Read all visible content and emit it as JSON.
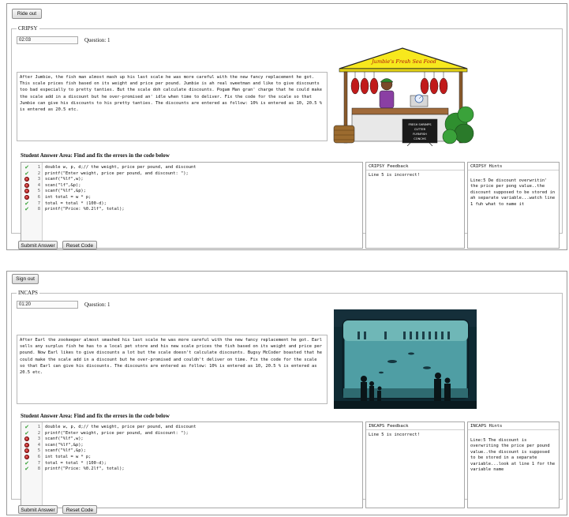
{
  "top": {
    "logout_label": "Ride out",
    "legend": "CRIPSY",
    "timer": "02:03",
    "question_label": "Question: 1",
    "question_text": "After Jumbie, the fish man almost mash up his last scale he was more careful with the new fancy replacement he got. This scale prices fish based on its weight and price per pound. Jumbie is ah real sweetman and like to give discounts too bad especially to pretty tanties. But the scale doh calculate discounts. Pogam Man gran' charge that he could make the scale add in a discount but he over-promised an' idle when time to deliver. Fix the code for the scale so that Jumbie can give his discounts to his pretty tanties. The discounts are entered as follow: 10% is entered as 10, 20.5 % is entered as 20.5 etc.",
    "illustration": {
      "sign": "Jumbie's Fresh Sea Food",
      "board": "FRESH SHRIMPS\nCUTTER\nFLYINFISH\nCONCHS"
    },
    "answer_label": "Student Answer Area: Find and fix the errors in the code below",
    "code_lines": [
      {
        "num": "1",
        "status": "ok",
        "text": "double w, p, d;// the weight, price per pound, and discount"
      },
      {
        "num": "2",
        "status": "ok",
        "text": "printf(\"Enter weight, price per pound, and discount: \");"
      },
      {
        "num": "3",
        "status": "err",
        "text": "scanf(\"%lf\",w);"
      },
      {
        "num": "4",
        "status": "err",
        "text": "scan(\"lf\",&p);"
      },
      {
        "num": "5",
        "status": "err",
        "text": "scanf(\"%lf\",&p);"
      },
      {
        "num": "6",
        "status": "err",
        "text": "int total = w * p;"
      },
      {
        "num": "7",
        "status": "ok",
        "text": "total = total * (100-d);"
      },
      {
        "num": "8",
        "status": "ok",
        "text": "printf(\"Price: %0.2lf\", total);"
      }
    ],
    "feedback_title": "CRIPSY Feedback",
    "feedback_text": "Line 5 is incorrect!",
    "hints_title": "CRIPSY Hints",
    "hints_text": "Line:5  De discount overwritin' the price per pong value..the discount supposed to be stored in ah separate variable...watch line 1 fuh what to name it",
    "submit_label": "Submit Answer",
    "reset_label": "Reset Code"
  },
  "bottom": {
    "logout_label": "Sign out",
    "legend": "INCAPS",
    "timer": "01:20",
    "question_label": "Question: 1",
    "question_text": "After Earl the zookeeper almost smashed his last scale he was more careful with the new fancy replacement he got. Earl sells any surplus fish he has to a local pet store and his new scale prices the fish based on its weight and price per pound. Now Earl likes to give discounts a lot but the scale doesn't calculate discounts. Bugsy McCoder boasted that he could make the scale add in a discount but he over-promised and couldn't deliver on time. Fix the code for the scale so that Earl can give his discounts. The discounts are entered as follow: 10% is entered as 10, 20.5 % is entered as 20.5 etc.",
    "answer_label": "Student Answer Area: Find and fix the errors in the code below",
    "code_lines": [
      {
        "num": "1",
        "status": "ok",
        "text": "double w, p, d;// the weight, price per pound, and discount"
      },
      {
        "num": "2",
        "status": "ok",
        "text": "printf(\"Enter weight, price per pound, and discount: \");"
      },
      {
        "num": "3",
        "status": "err",
        "text": "scanf(\"%lf\",w);"
      },
      {
        "num": "4",
        "status": "err",
        "text": "scan(\"%lf\",&p);"
      },
      {
        "num": "5",
        "status": "err",
        "text": "scanf(\"%lf\",&p);"
      },
      {
        "num": "6",
        "status": "err",
        "text": "int total = w * p;"
      },
      {
        "num": "7",
        "status": "ok",
        "text": "total = total * (100-d);"
      },
      {
        "num": "8",
        "status": "ok",
        "text": "printf(\"Price: %0.2lf\", total);"
      }
    ],
    "feedback_title": "INCAPS Feedback",
    "feedback_text": "Line 5 is incorrect!",
    "hints_title": "INCAPS Hints",
    "hints_text": "Line:5  The discount is overwriting the price per pound value..the discount is supposed to be stored in a separate variable...look at line 1 for the variable name",
    "submit_label": "Submit Answer",
    "reset_label": "Reset Code"
  },
  "colors": {
    "ok_mark": "#3aa23a",
    "err_mark": "#c01818",
    "awning": "#f7e81d",
    "aquarium_water": "#4f9ea4"
  }
}
